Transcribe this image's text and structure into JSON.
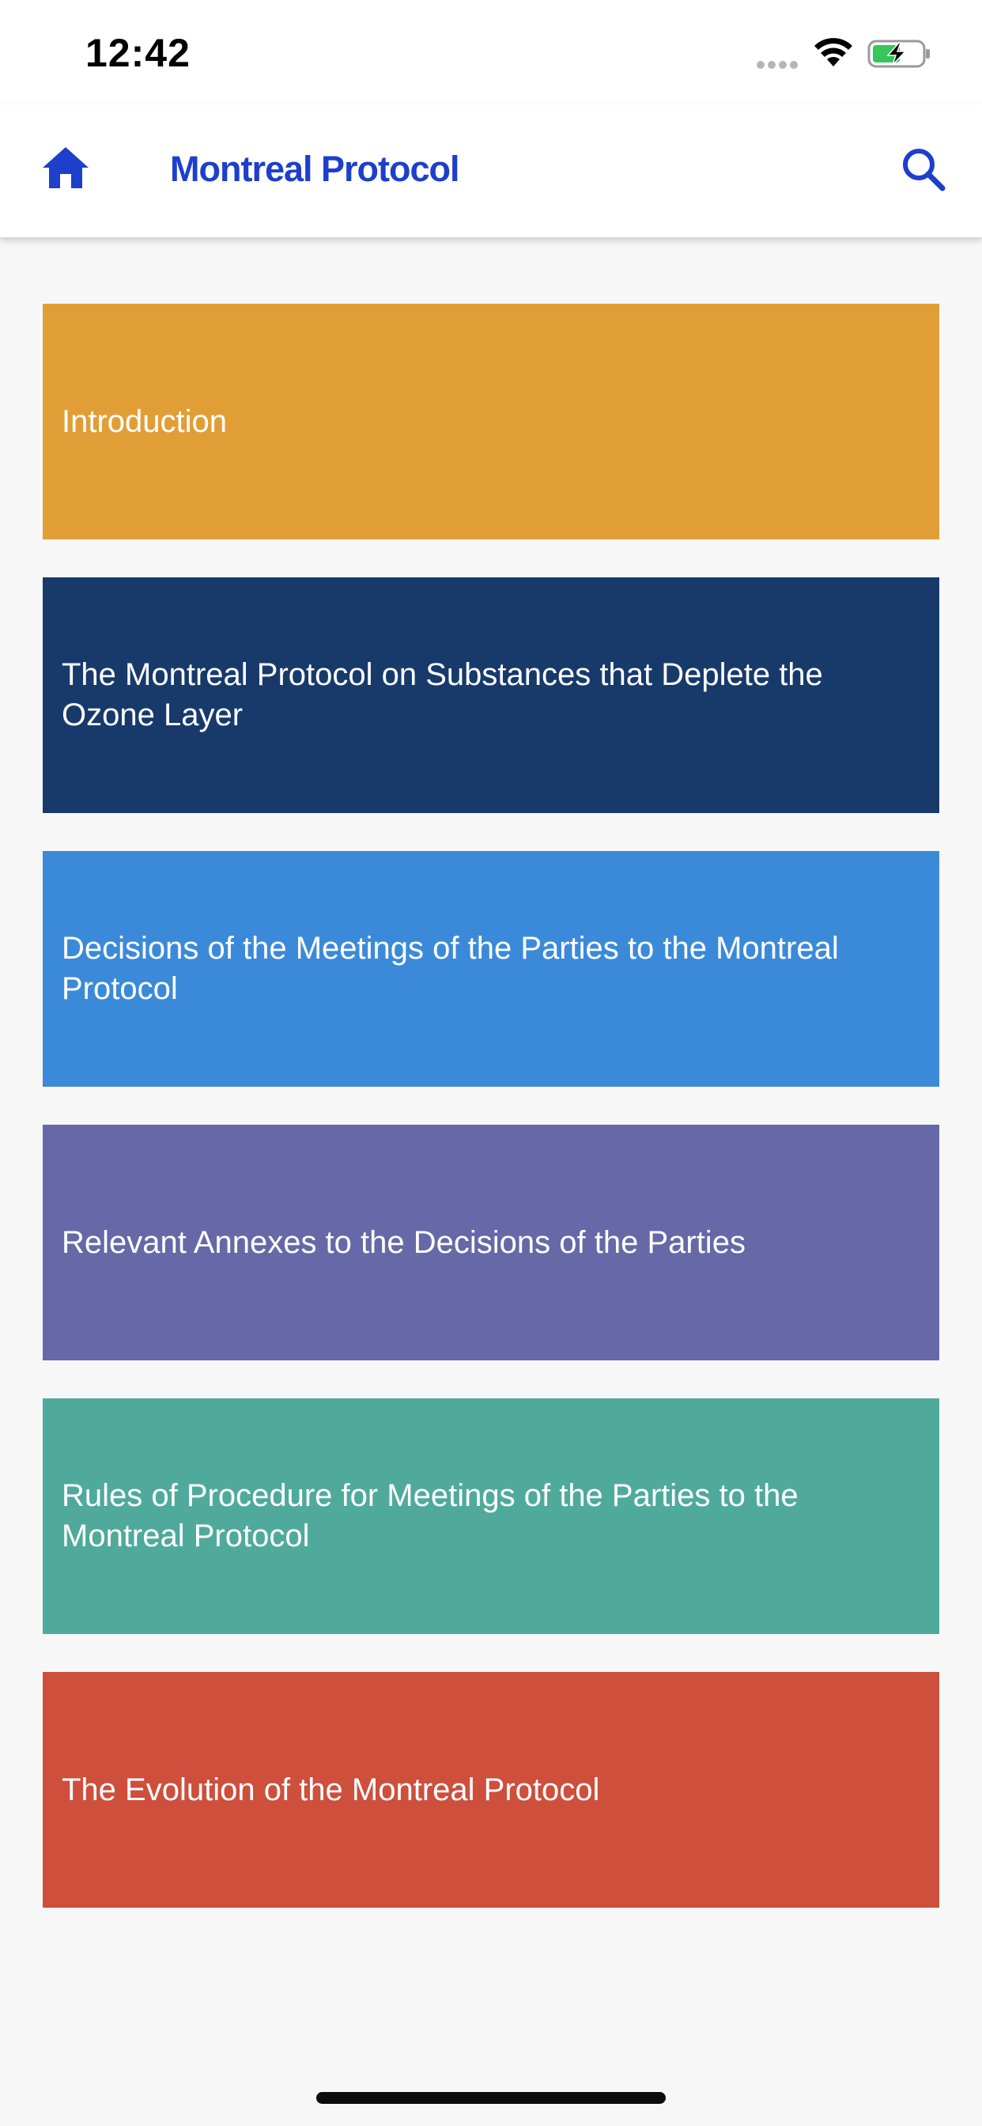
{
  "status_bar": {
    "time": "12:42"
  },
  "nav": {
    "title": "Montreal Protocol",
    "left_icon": "home-icon",
    "right_icon": "search-icon",
    "accent_color": "#1d3fcc"
  },
  "menu": {
    "items": [
      {
        "label": "Introduction",
        "color": "#e29e36"
      },
      {
        "label": "The Montreal Protocol on Substances that Deplete the Ozone Layer",
        "color": "#173a6b"
      },
      {
        "label": "Decisions of the Meetings of the Parties to the Montreal Protocol",
        "color": "#3b8ad9"
      },
      {
        "label": "Relevant Annexes to the Decisions of the Parties",
        "color": "#6668a7"
      },
      {
        "label": "Rules of Procedure for Meetings of the Parties to the Montreal Protocol",
        "color": "#4faa9c"
      },
      {
        "label": "The Evolution of the Montreal Protocol",
        "color": "#cd4f3c"
      }
    ]
  }
}
